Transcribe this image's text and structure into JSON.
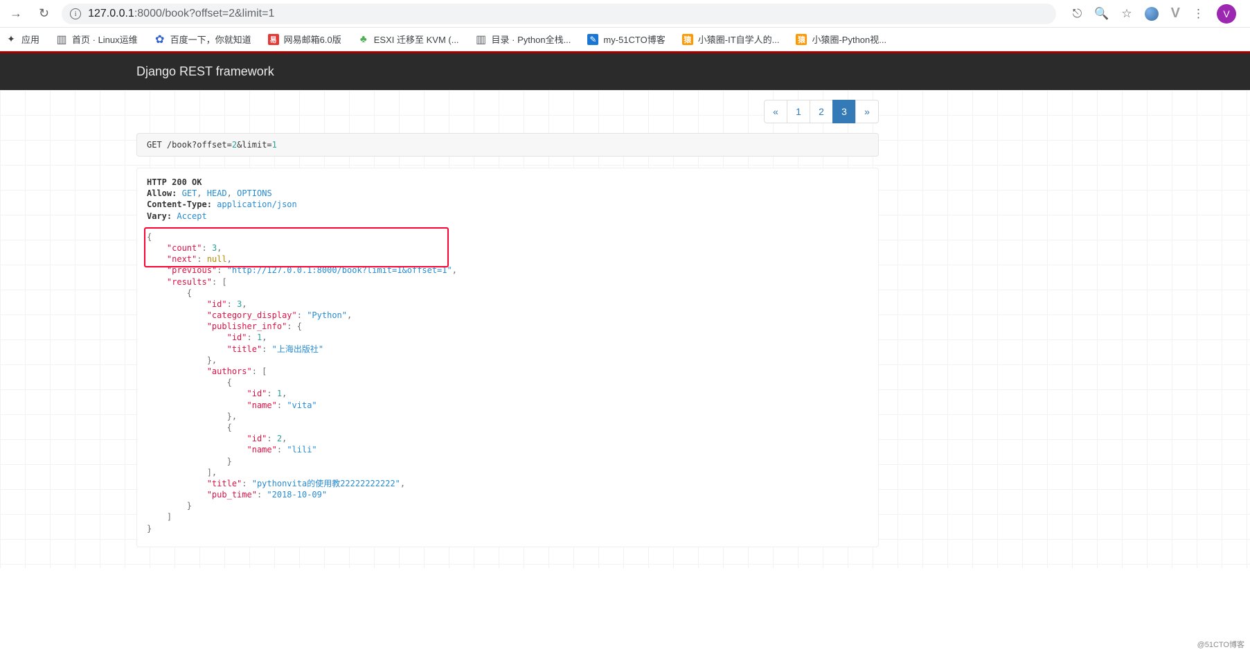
{
  "browser": {
    "url_host": "127.0.0.1",
    "url_port": ":8000",
    "url_path": "/book?offset=2&limit=1",
    "avatar_letter": "V"
  },
  "bookmarks": {
    "apps": "应用",
    "b1": "首页 · Linux运维",
    "b2": "百度一下，你就知道",
    "b3": "网易邮箱6.0版",
    "b4": "ESXI 迁移至 KVM (...",
    "b5": "目录 · Python全栈...",
    "b6": "my-51CTO博客",
    "b7": "小猿圈-IT自学人的...",
    "b8": "小猿圈-Python视..."
  },
  "navbar": {
    "brand": "Django REST framework"
  },
  "pagination": {
    "prev": "«",
    "p1": "1",
    "p2": "2",
    "p3": "3",
    "next": "»"
  },
  "request": {
    "method": "GET",
    "path_a": " /book?offset=",
    "off": "2",
    "amp": "&limit=",
    "lim": "1"
  },
  "response_headers": {
    "status_line": "HTTP 200 OK",
    "allow_k": "Allow:",
    "allow_get": "GET",
    "allow_head": "HEAD",
    "allow_options": "OPTIONS",
    "ct_k": "Content-Type:",
    "ct_v": "application/json",
    "vary_k": "Vary:",
    "vary_v": "Accept"
  },
  "json": {
    "count_k": "\"count\"",
    "count_v": "3",
    "next_k": "\"next\"",
    "next_v": "null",
    "prev_k": "\"previous\"",
    "prev_v": "\"http://127.0.0.1:8000/book?limit=1&offset=1\"",
    "results_k": "\"results\"",
    "id_k": "\"id\"",
    "id_v_3": "3",
    "catdisp_k": "\"category_display\"",
    "catdisp_v": "\"Python\"",
    "pubinfo_k": "\"publisher_info\"",
    "pub_id_v": "1",
    "title_k": "\"title\"",
    "pub_title_v": "\"上海出版社\"",
    "authors_k": "\"authors\"",
    "a1_id": "1",
    "name_k": "\"name\"",
    "a1_name": "\"vita\"",
    "a2_id": "2",
    "a2_name": "\"lili\"",
    "book_title_v": "\"pythonvita的使用教22222222222\"",
    "pubtime_k": "\"pub_time\"",
    "pubtime_v": "\"2018-10-09\""
  },
  "watermark": "@51CTO博客"
}
